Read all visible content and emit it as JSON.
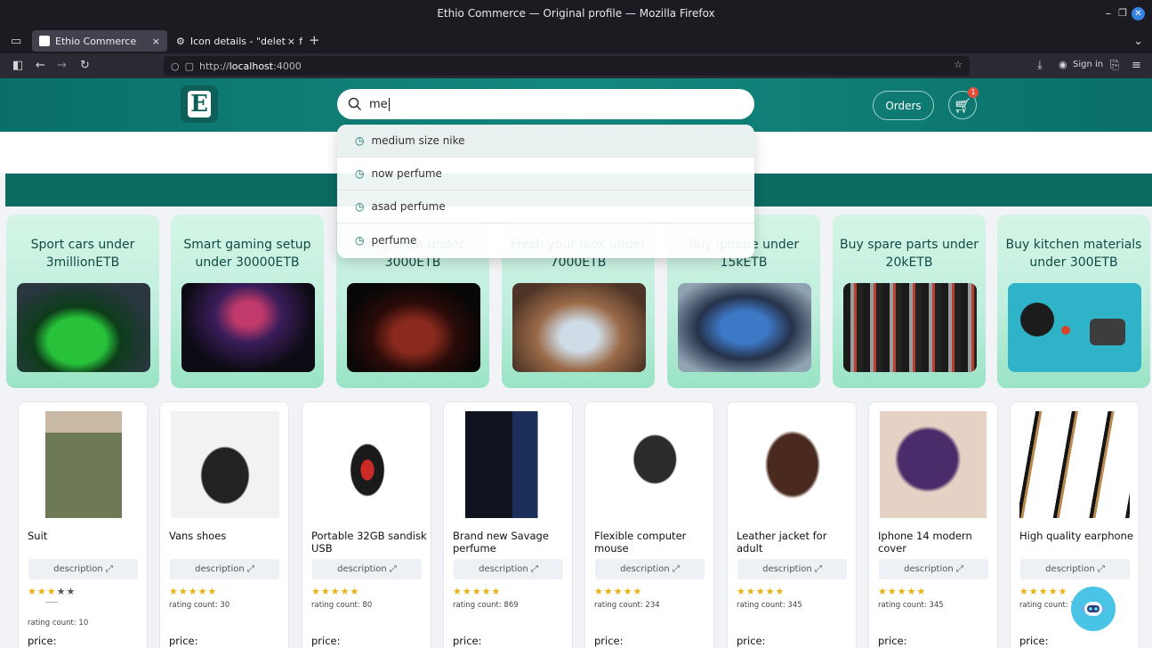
{
  "browser": {
    "window_title": "Ethio Commerce — Original profile — Mozilla Firefox",
    "tabs": [
      {
        "label": "Ethio Commerce",
        "close": "×"
      },
      {
        "label": "Icon details - \"delete\" from /",
        "close": "×"
      }
    ],
    "new_tab": "+",
    "url_prefix": "http://",
    "url_host": "localhost",
    "url_port": ":4000",
    "sign_in": "Sign in"
  },
  "header": {
    "logo_letter": "E",
    "search_value": "me",
    "orders_label": "Orders",
    "cart_badge": "1"
  },
  "suggestions": [
    "medium size nike",
    "now perfume",
    "asad perfume",
    "perfume"
  ],
  "categories": [
    {
      "title": "Sport cars under 3millionETB"
    },
    {
      "title": "Smart gaming setup under 30000ETB"
    },
    {
      "title": "Fragrance under 3000ETB"
    },
    {
      "title": "Fresh your look under 7000ETB"
    },
    {
      "title": "Buy iphone under 15kETB"
    },
    {
      "title": "Buy spare parts under 20kETB"
    },
    {
      "title": "Buy kitchen materials under 300ETB"
    }
  ],
  "products": [
    {
      "name": "Suit",
      "desc": "description",
      "stars": "★★★★★",
      "rating": "rating count: 10",
      "price": "price:"
    },
    {
      "name": "Vans shoes",
      "desc": "description",
      "stars": "★★★★★",
      "rating": "rating count: 30",
      "price": "price:"
    },
    {
      "name": "Portable 32GB sandisk USB",
      "desc": "description",
      "stars": "★★★★★",
      "rating": "rating count: 80",
      "price": "price:"
    },
    {
      "name": "Brand new Savage perfume",
      "desc": "description",
      "stars": "★★★★★",
      "rating": "rating count: 869",
      "price": "price:"
    },
    {
      "name": "Flexible computer mouse",
      "desc": "description",
      "stars": "★★★★★",
      "rating": "rating count: 234",
      "price": "price:"
    },
    {
      "name": "Leather jacket for adult",
      "desc": "description",
      "stars": "★★★★★",
      "rating": "rating count: 345",
      "price": "price:"
    },
    {
      "name": "Iphone 14 modern cover",
      "desc": "description",
      "stars": "★★★★★",
      "rating": "rating count: 345",
      "price": "price:"
    },
    {
      "name": "High quality earphone",
      "desc": "description",
      "stars": "★★★★★",
      "rating": "rating count: 7",
      "price": "price:"
    }
  ],
  "colors": {
    "brand_teal": "#0b6b63",
    "star_gold": "#e8b10f",
    "chat_bot": "#49c4e6"
  }
}
